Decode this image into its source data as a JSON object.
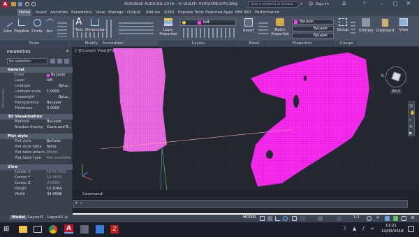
{
  "window": {
    "title": "Autodesk AutoCAD 2016 - STUDENT VERSION",
    "filename": "COPO.dwg",
    "search_placeholder": "Type a keyword or phrase",
    "sign_in": "Sign In"
  },
  "ribbon": {
    "tabs": [
      "Home",
      "Insert",
      "Annotate",
      "Parametric",
      "View",
      "Manage",
      "Output",
      "Add-ins",
      "A360",
      "Express Tools",
      "Featured Apps",
      "BIM 360",
      "Performance"
    ],
    "active_tab": "Home",
    "draw_tools": [
      "Line",
      "Polyline",
      "Circle",
      "Arc"
    ],
    "annotation_tools": [
      "Text",
      "Dimension"
    ],
    "layer_tool": "Layer\nProperties",
    "layer_current": "loft",
    "insert": "Insert",
    "match_properties": "Match\nProperties",
    "prop_color": "ByLayer",
    "prop_linetype": "ByLayer",
    "prop_lineweight": "ByLayer",
    "group": "Group",
    "utilities": "Utilities",
    "clipboard": "Clipboard",
    "view": "View",
    "panels": [
      "Draw",
      "Modify",
      "Annotation",
      "Layers",
      "Block",
      "Properties",
      "Groups"
    ]
  },
  "properties_palette": {
    "title": "PROPERTIES",
    "selection": "No selection",
    "sections": [
      {
        "name": "General",
        "rows": [
          [
            "Color",
            "ByLayer"
          ],
          [
            "Layer",
            "loft"
          ],
          [
            "Linetype",
            "ByLa..."
          ],
          [
            "Linetype scale",
            "1.0000"
          ],
          [
            "Lineweight",
            "ByLa..."
          ],
          [
            "Transparency",
            "ByLayer"
          ],
          [
            "Thickness",
            "0.0000"
          ]
        ]
      },
      {
        "name": "3D Visualization",
        "rows": [
          [
            "Material",
            "ByLayer"
          ],
          [
            "Shadow display",
            "Casts and R..."
          ]
        ]
      },
      {
        "name": "Plot style",
        "rows": [
          [
            "Plot style",
            "ByColor"
          ],
          [
            "Plot style table",
            "None"
          ],
          [
            "Plot table attach...",
            "Model"
          ],
          [
            "Plot table type",
            "Not available"
          ]
        ]
      },
      {
        "name": "View",
        "rows": [
          [
            "Center X",
            "1074.7821"
          ],
          [
            "Center Y",
            "10.5670"
          ],
          [
            "Center Z",
            "0.0000"
          ],
          [
            "Height",
            "15.9764"
          ],
          [
            "Width",
            "44.9598"
          ]
        ]
      }
    ]
  },
  "viewport": {
    "label": "[-][Custom View][Flat]",
    "viewcube": "N",
    "wcs": "WCS"
  },
  "command": {
    "label": "Command:",
    "prompt": "Type a command"
  },
  "layout_tabs": [
    "Model",
    "Layout1",
    "Layout2"
  ],
  "status": {
    "model": "MODEL",
    "scale": "1:1"
  },
  "taskbar": {
    "time": "11:21",
    "date": "12/03/2018"
  },
  "colors": {
    "accent_magenta": "#ff3df5",
    "viewport_bg": "#222730",
    "ribbon_bg": "#4a5366"
  }
}
